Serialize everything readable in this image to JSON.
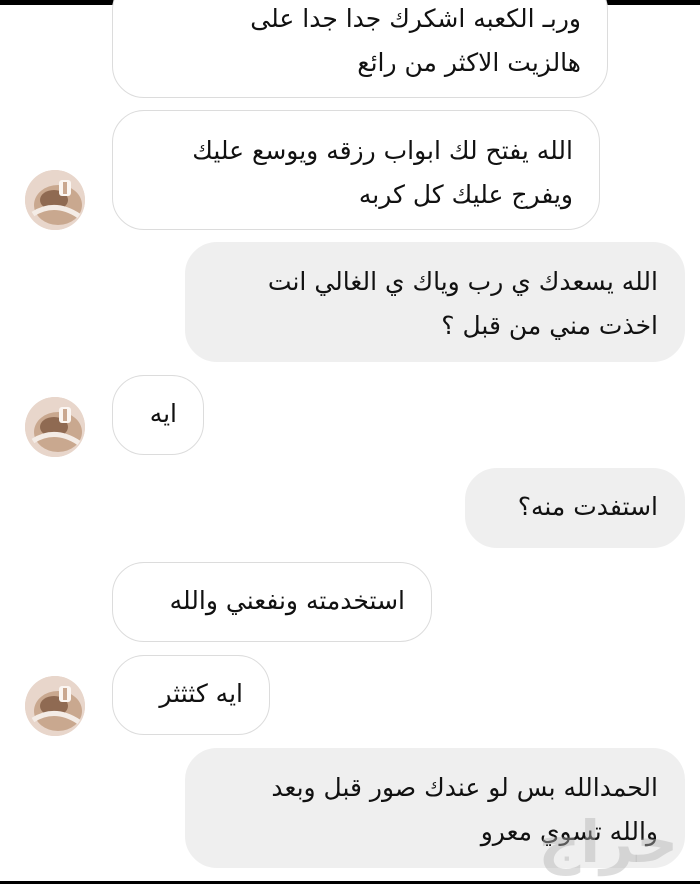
{
  "messages": [
    {
      "side": "in",
      "avatar": false,
      "lines": [
        "وربـ الكعبه اشكرك جدا جدا على",
        "هالزيت الاكثر من رائع"
      ]
    },
    {
      "side": "in",
      "avatar": true,
      "lines": [
        "الله يفتح لك ابواب رزقه ويوسع عليك",
        "ويفرج عليك كل كربه"
      ]
    },
    {
      "side": "out",
      "avatar": false,
      "lines": [
        "الله يسعدك ي رب وياك ي الغالي انت",
        "اخذت مني من قبل ؟"
      ]
    },
    {
      "side": "in",
      "avatar": true,
      "lines": [
        "ايه"
      ]
    },
    {
      "side": "out",
      "avatar": false,
      "lines": [
        "استفدت منه؟"
      ]
    },
    {
      "side": "in",
      "avatar": false,
      "lines": [
        "استخدمته ونفعني والله"
      ]
    },
    {
      "side": "in",
      "avatar": true,
      "lines": [
        "ايه كثثثر"
      ]
    },
    {
      "side": "out",
      "avatar": false,
      "lines": [
        "الحمدالله بس لو عندك صور قبل وبعد",
        "والله تسوي معرو"
      ]
    }
  ],
  "avatar_icon": "profile-photo",
  "watermark": {
    "text": "حراج"
  }
}
